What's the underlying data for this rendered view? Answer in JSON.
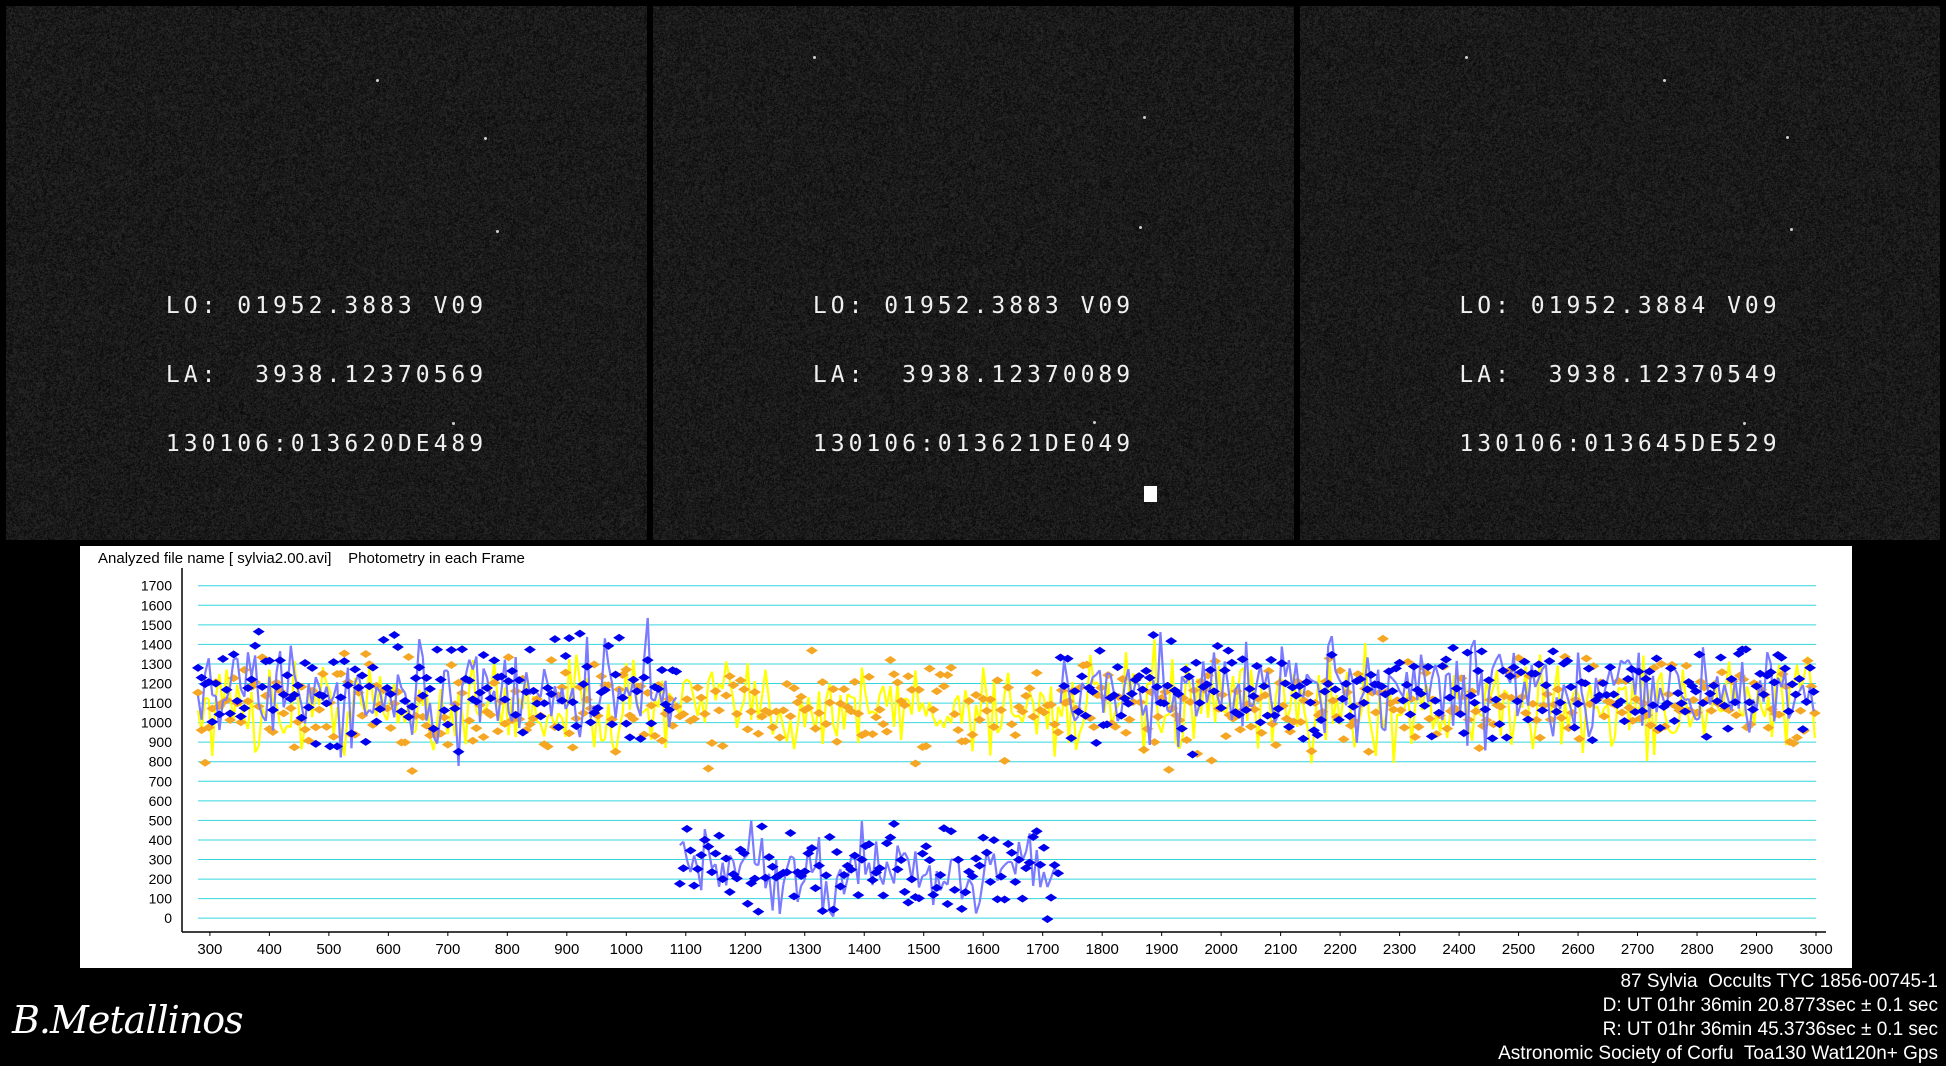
{
  "panels": [
    {
      "lines": [
        "LO: 01952.3883 V09",
        "LA:  3938.12370569",
        "130106:013620DE489"
      ]
    },
    {
      "lines": [
        "LO: 01952.3883 V09",
        "LA:  3938.12370089",
        "130106:013621DE049"
      ]
    },
    {
      "lines": [
        "LO: 01952.3884 V09",
        "LA:  3938.12370549",
        "130106:013645DE529"
      ]
    }
  ],
  "chart_header": {
    "file_label": "Analyzed file name [ sylvia2.00.avi]",
    "mode_label": "Photometry in each Frame"
  },
  "chart_data": {
    "type": "line",
    "x_ticks": [
      300,
      400,
      500,
      600,
      700,
      800,
      900,
      1000,
      1100,
      1200,
      1300,
      1400,
      1500,
      1600,
      1700,
      1800,
      1900,
      2000,
      2100,
      2200,
      2300,
      2400,
      2500,
      2600,
      2700,
      2800,
      2900,
      3000
    ],
    "y_ticks": [
      0,
      100,
      200,
      300,
      400,
      500,
      600,
      700,
      800,
      900,
      1000,
      1100,
      1200,
      1300,
      1400,
      1500,
      1600,
      1700
    ],
    "xlim": [
      280,
      3000
    ],
    "ylim": [
      -40,
      1760
    ],
    "grid": true,
    "series": [
      {
        "color": "#f5a623",
        "stem_color": "#ffff00",
        "segments": [
          {
            "x0": 280,
            "x1": 3000,
            "base": 1080,
            "noise": 220
          }
        ]
      },
      {
        "color": "#0000ee",
        "stem_color": "#7b7bff",
        "segments": [
          {
            "x0": 280,
            "x1": 1090,
            "base": 1150,
            "noise": 230
          },
          {
            "x0": 1090,
            "x1": 1730,
            "base": 250,
            "noise": 190
          },
          {
            "x0": 1730,
            "x1": 3000,
            "base": 1170,
            "noise": 220
          }
        ]
      }
    ],
    "event_start": 1100,
    "event_end": 1720
  },
  "caption": {
    "line1": "87 Sylvia  Occults TYC 1856-00745-1",
    "line2": "D: UT 01hr 36min 20.8773sec ± 0.1 sec",
    "line3": "R: UT 01hr 36min 45.3736sec ± 0.1 sec",
    "line4": "Astronomic Society of Corfu  Toa130 Wat120n+ Gps"
  },
  "signature": "B.Metallinos"
}
